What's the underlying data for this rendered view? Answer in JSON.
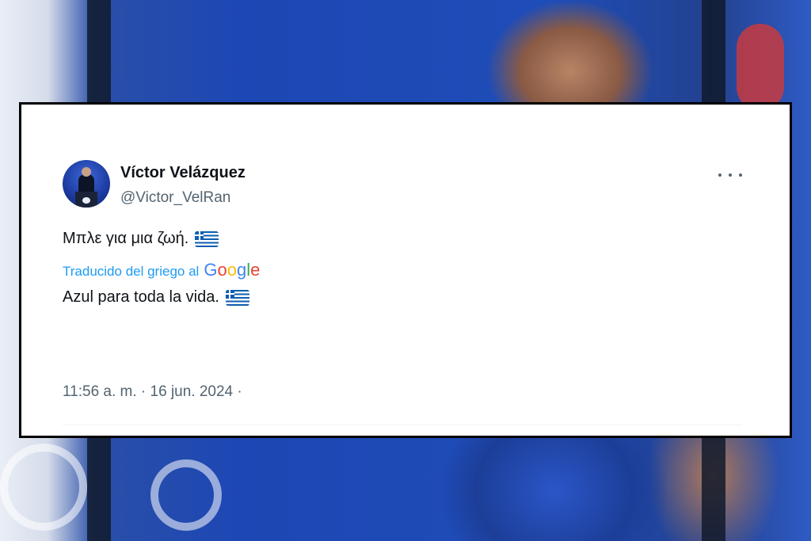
{
  "tweet": {
    "author_name": "Víctor Velázquez",
    "author_handle": "@Victor_VelRan",
    "original_text": "Μπλε για μια ζωή.",
    "translation_label": "Traducido del griego al",
    "translation_provider": "Google",
    "translated_text": "Azul para toda la vida.",
    "timestamp": "11:56 a. m. · 16 jun. 2024 ·",
    "flag_emoji_name": "greece-flag-icon",
    "more_icon_name": "more-options-icon"
  },
  "colors": {
    "card_border": "#000000",
    "text_primary": "#0f1419",
    "text_secondary": "#536471",
    "link_blue": "#1d9bf0",
    "google_blue": "#4285F4",
    "google_red": "#EA4335",
    "google_yellow": "#FBBC05",
    "google_green": "#34A853"
  }
}
